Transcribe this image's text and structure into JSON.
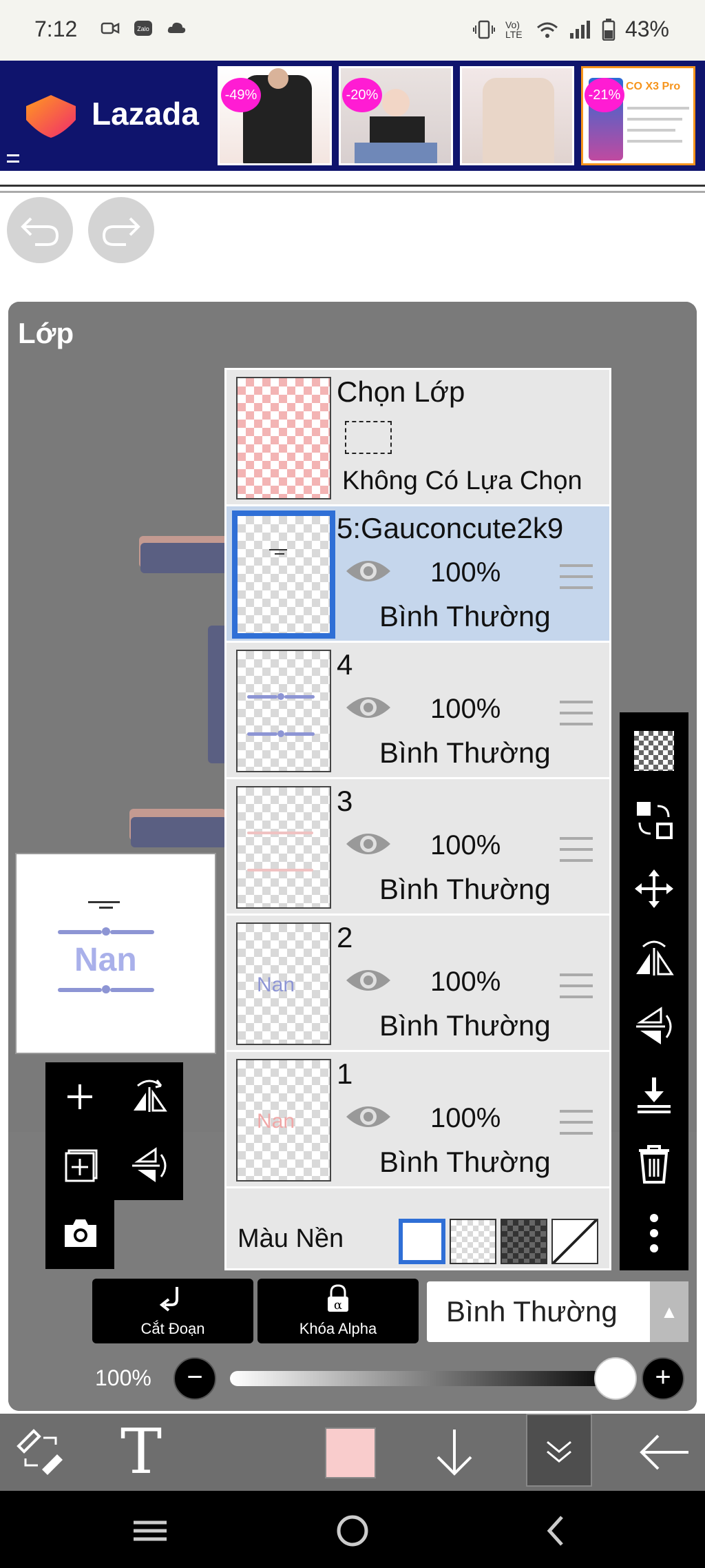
{
  "status_bar": {
    "time": "7:12",
    "battery": "43%",
    "volte_label": "Vo) LTE"
  },
  "ad": {
    "brand": "Lazada",
    "products": [
      {
        "discount": "-49%"
      },
      {
        "discount": "-20%"
      },
      {
        "discount": ""
      },
      {
        "discount": "-21%",
        "overlay_text": "CO X3 Pro"
      }
    ]
  },
  "panel": {
    "title": "Lớp",
    "preview_text": "Nan"
  },
  "selection_row": {
    "title": "Chọn Lớp",
    "subtitle": "Không Có Lựa Chọn"
  },
  "layers": [
    {
      "name": "5:Gauconcute2k9",
      "opacity": "100%",
      "blend": "Bình Thường",
      "selected": true
    },
    {
      "name": "4",
      "opacity": "100%",
      "blend": "Bình Thường",
      "selected": false
    },
    {
      "name": "3",
      "opacity": "100%",
      "blend": "Bình Thường",
      "selected": false
    },
    {
      "name": "2",
      "opacity": "100%",
      "blend": "Bình Thường",
      "selected": false,
      "thumb_text": "Nan"
    },
    {
      "name": "1",
      "opacity": "100%",
      "blend": "Bình Thường",
      "selected": false,
      "thumb_text": "Nan"
    }
  ],
  "background_row": {
    "label": "Màu Nền"
  },
  "bottom_controls": {
    "clip_label": "Cắt Đoạn",
    "alpha_lock_label": "Khóa Alpha",
    "blend_mode": "Bình Thường",
    "opacity_value": "100%",
    "opacity_level": 1.0
  },
  "toolbar": {
    "current_color": "#f9cccc",
    "text_tool_glyph": "T"
  },
  "colors": {
    "selection_blue": "#2f6fd6",
    "selected_row": "#c5d6ec",
    "ad_background": "#0f146d",
    "badge_pink": "#ff1cd3"
  }
}
